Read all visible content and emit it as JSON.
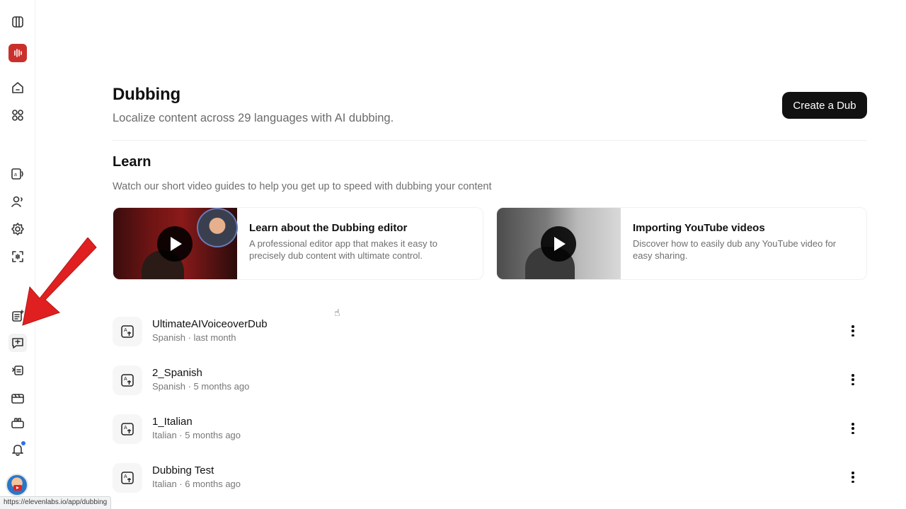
{
  "page": {
    "title": "Dubbing",
    "subtitle": "Localize content across 29 languages with AI dubbing.",
    "create_button": "Create a Dub"
  },
  "learn": {
    "title": "Learn",
    "subtitle": "Watch our short video guides to help you get up to speed with dubbing your content",
    "cards": [
      {
        "title": "Learn about the Dubbing editor",
        "description": "A professional editor app that makes it easy to precisely dub content with ultimate control."
      },
      {
        "title": "Importing YouTube videos",
        "description": "Discover how to easily dub any YouTube video for easy sharing."
      }
    ]
  },
  "dubs": [
    {
      "name": "UltimateAIVoiceoverDub",
      "meta": "Spanish · last month"
    },
    {
      "name": "2_Spanish",
      "meta": "Spanish · 5 months ago"
    },
    {
      "name": "1_Italian",
      "meta": "Italian · 5 months ago"
    },
    {
      "name": "Dubbing Test",
      "meta": "Italian · 6 months ago"
    }
  ],
  "sidebar": {
    "icons": [
      "columns-icon",
      "voice-brand-icon",
      "home-icon",
      "apps-icon",
      "text-to-speech-icon",
      "voices-icon",
      "settings-gear-icon",
      "voice-isolator-icon",
      "projects-icon",
      "dubbing-icon",
      "audio-native-icon",
      "studio-icon",
      "workspace-icon",
      "bell-icon"
    ],
    "active": "dubbing-icon"
  },
  "status_bar": {
    "url": "https://elevenlabs.io/app/dubbing"
  },
  "colors": {
    "accent": "#111111",
    "brand": "#c9302c",
    "annotation_arrow": "#e02020"
  }
}
